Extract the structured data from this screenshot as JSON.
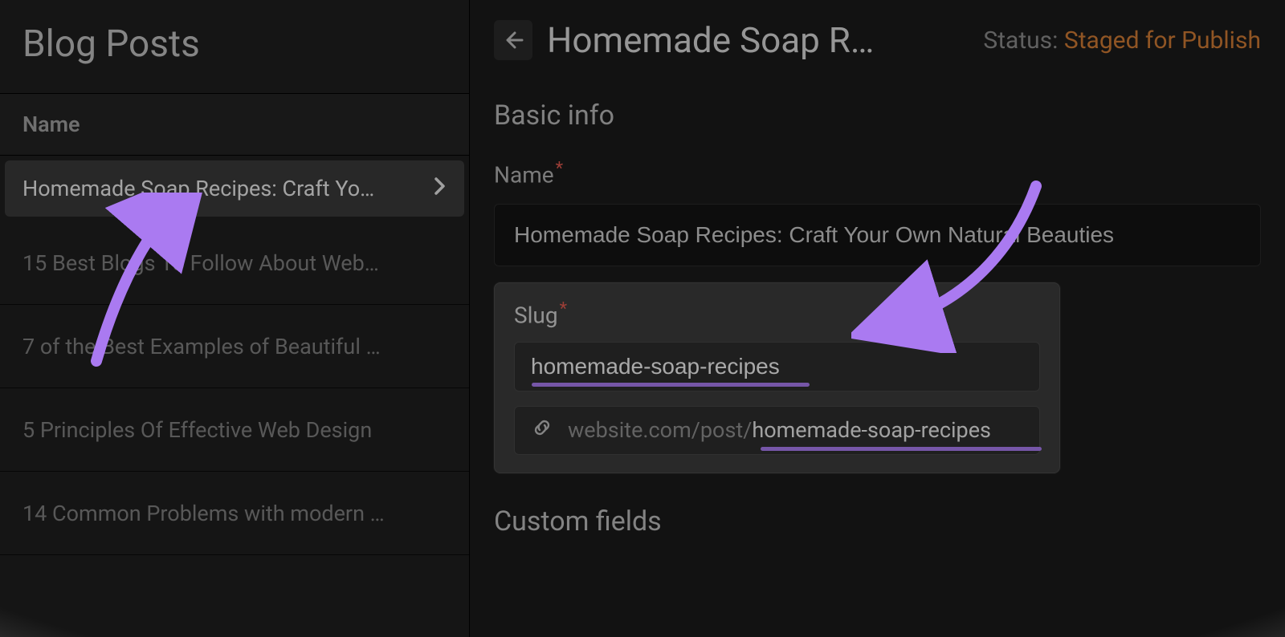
{
  "sidebar": {
    "title": "Blog Posts",
    "column_header": "Name",
    "items": [
      {
        "label": "Homemade Soap Recipes: Craft Yo…",
        "selected": true
      },
      {
        "label": "15 Best Blogs To Follow About Web…",
        "selected": false
      },
      {
        "label": "7 of the Best Examples of Beautiful …",
        "selected": false
      },
      {
        "label": "5 Principles Of Effective Web Design",
        "selected": false
      },
      {
        "label": "14 Common Problems with modern …",
        "selected": false
      }
    ]
  },
  "main": {
    "page_title": "Homemade Soap R…",
    "status_label": "Status:",
    "status_value": "Staged for Publish",
    "sections": {
      "basic_info": {
        "title": "Basic info",
        "name_label": "Name",
        "name_value": "Homemade Soap Recipes: Craft Your Own Natural Beauties",
        "slug_label": "Slug",
        "slug_value": "homemade-soap-recipes",
        "url_prefix": "website.com/post/",
        "url_slug": "homemade-soap-recipes"
      },
      "custom_fields": {
        "title": "Custom fields"
      }
    }
  }
}
